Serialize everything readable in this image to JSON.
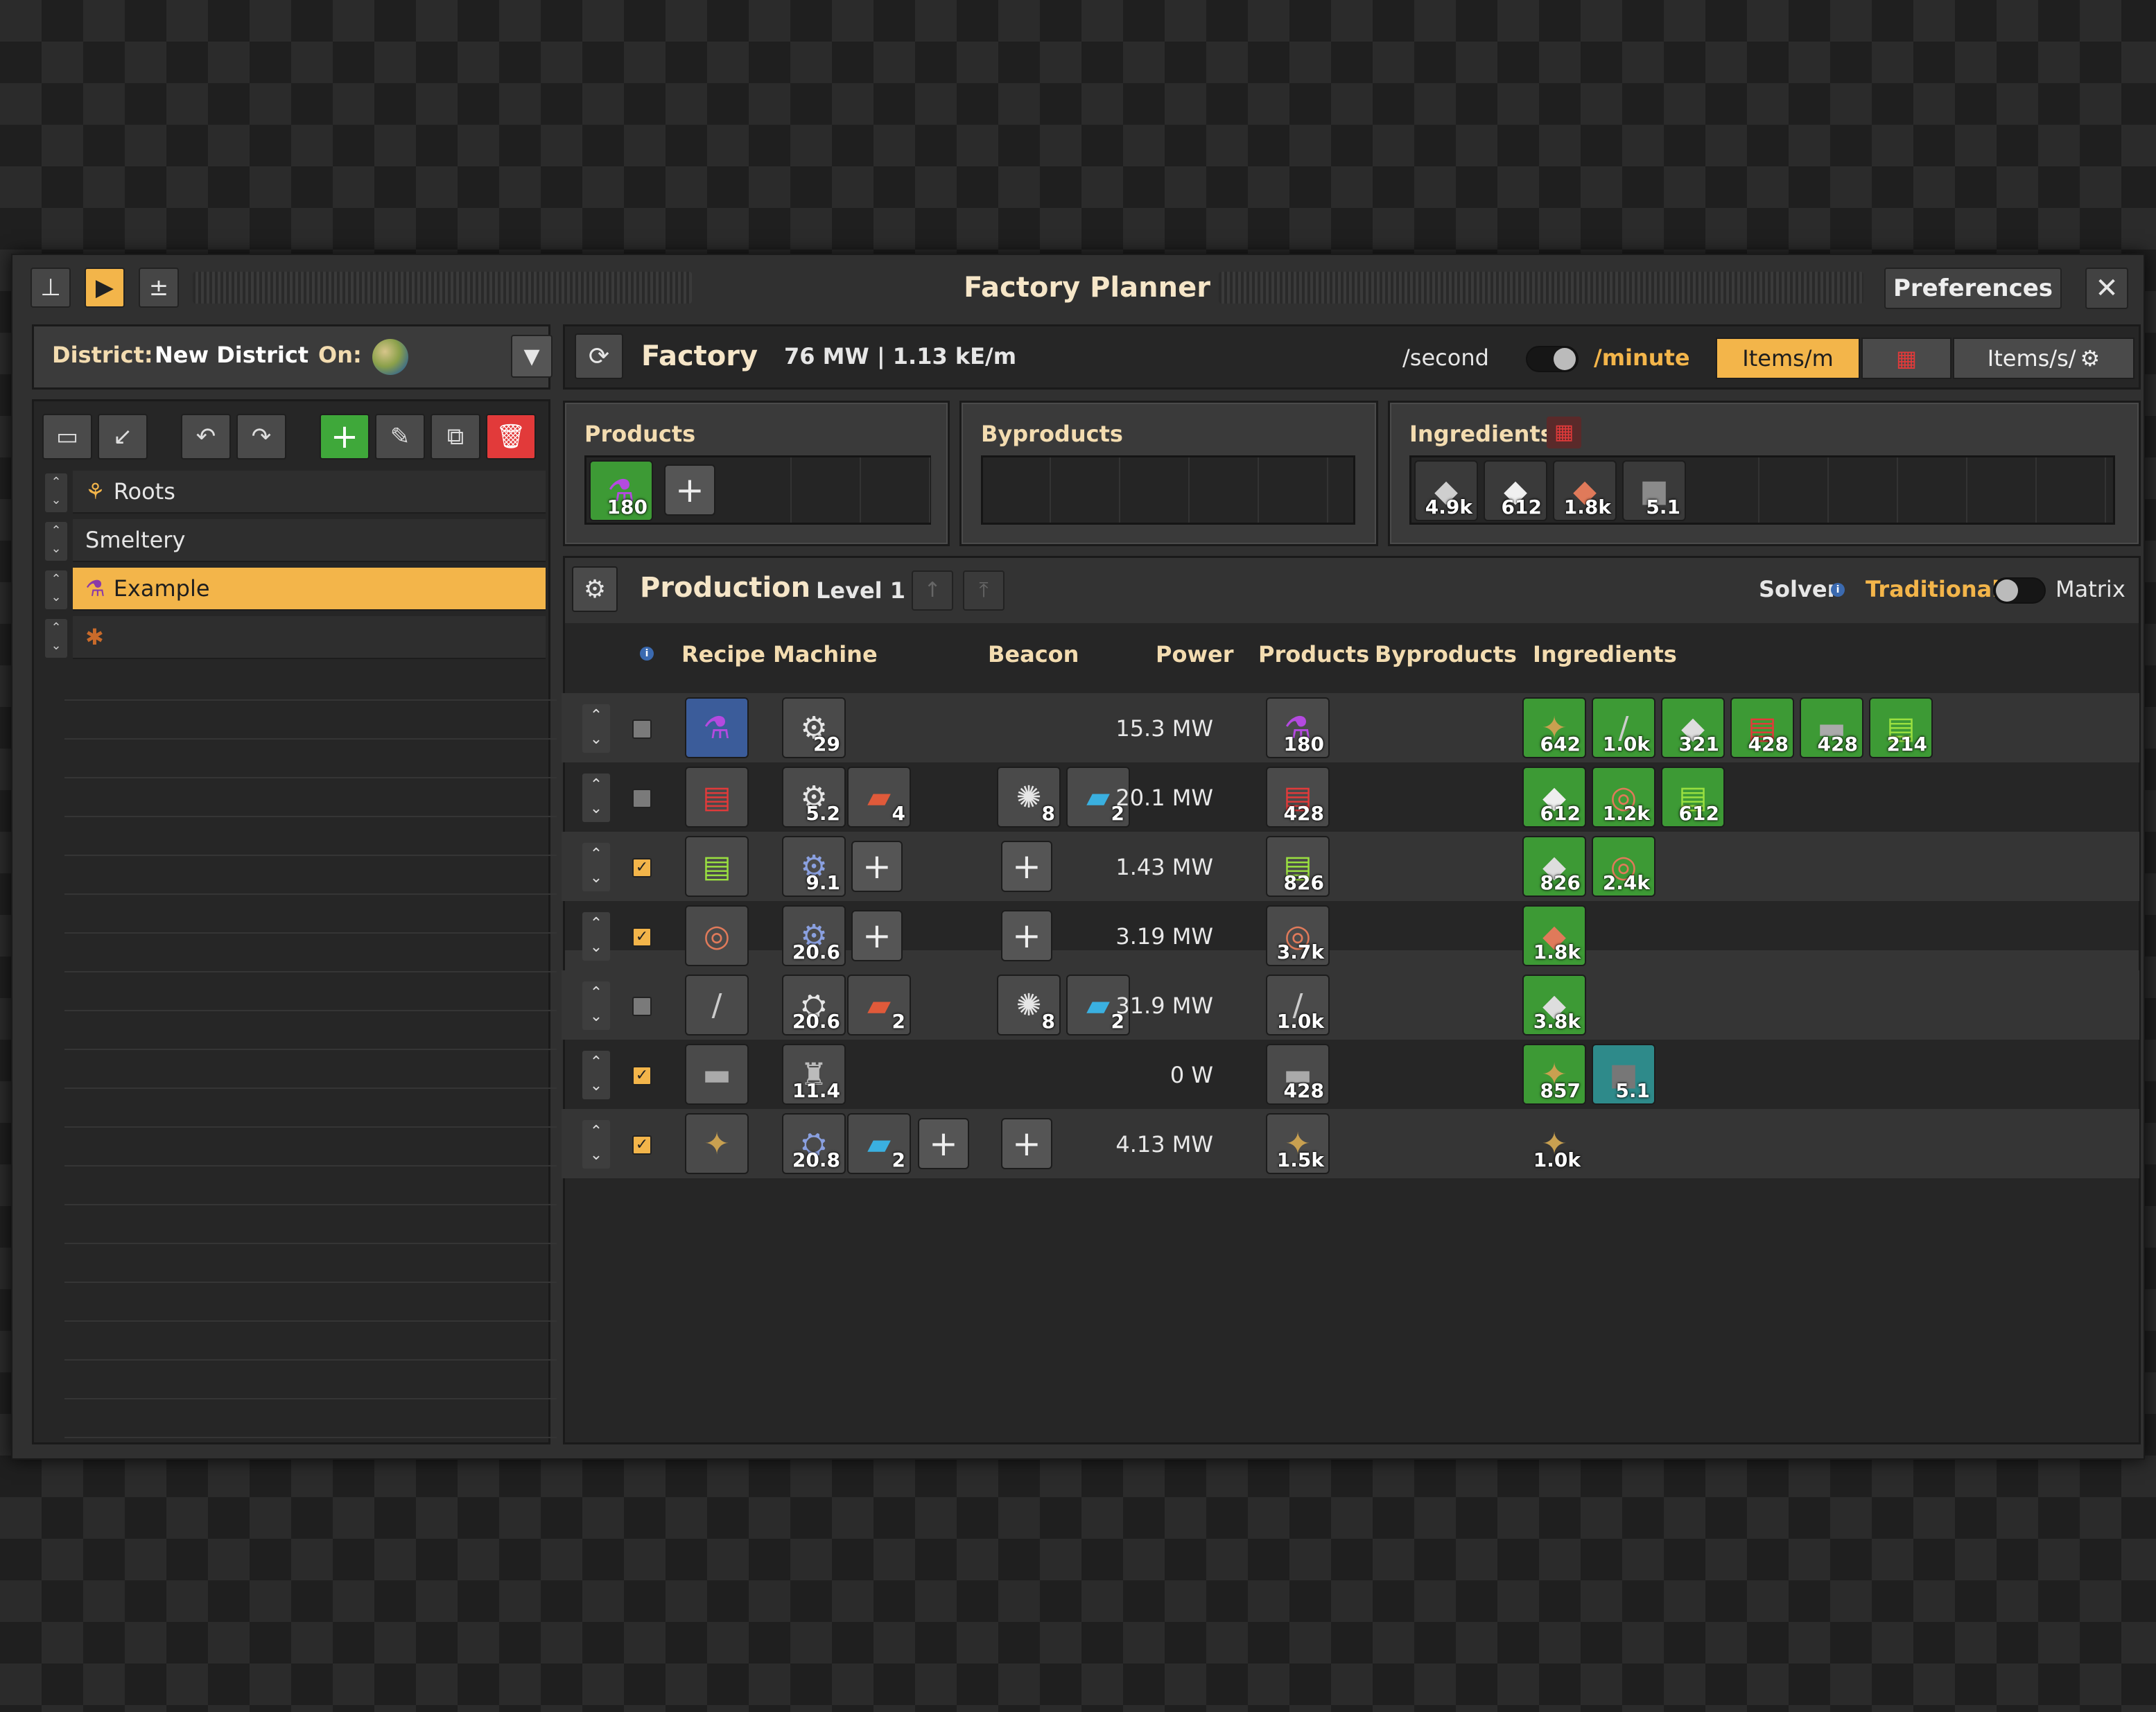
{
  "window": {
    "title": "Factory Planner",
    "preferences_label": "Preferences",
    "close_label": "✕",
    "pin_icon": "pin-icon",
    "pause_icon": "play-icon",
    "calc_icon": "plus-minus-icon"
  },
  "district": {
    "label": "District:",
    "name": "New District",
    "on_label": "On:",
    "planet_icon": "planet-icon"
  },
  "factory_list": {
    "items": [
      {
        "label": "Roots",
        "icon": "roots-icon",
        "selected": false
      },
      {
        "label": "Smeltery",
        "icon": "",
        "selected": false
      },
      {
        "label": "Example",
        "icon": "flask-icon",
        "selected": true
      },
      {
        "label": "",
        "icon": "spider-icon",
        "selected": false
      }
    ]
  },
  "factory_bar": {
    "title": "Factory",
    "stats": "76 MW | 1.13 kE/m",
    "per_second": "/second",
    "per_minute": "/minute",
    "view_items_m": "Items/m",
    "view_items_s": "Items/s/"
  },
  "products": {
    "title": "Products",
    "items": [
      {
        "icon": "purple-science-pack-icon",
        "count": "180"
      }
    ]
  },
  "byproducts": {
    "title": "Byproducts"
  },
  "ingredients": {
    "title": "Ingredients",
    "items": [
      {
        "icon": "iron-ore-icon",
        "count": "4.9k"
      },
      {
        "icon": "iron-plate-icon",
        "count": "612"
      },
      {
        "icon": "copper-ore-icon",
        "count": "1.8k"
      },
      {
        "icon": "stone-icon",
        "count": "5.1"
      }
    ]
  },
  "production": {
    "title": "Production",
    "level": "Level 1",
    "solver_label": "Solver",
    "solver_traditional": "Traditional",
    "solver_matrix": "Matrix",
    "columns": {
      "recipe": "Recipe",
      "machine": "Machine",
      "beacon": "Beacon",
      "power": "Power",
      "products": "Products",
      "byproducts": "Byproducts",
      "ingredients": "Ingredients"
    },
    "rows": [
      {
        "checked": false,
        "recipe_icon": "purple-science-icon",
        "machine": [
          {
            "icon": "assembler-icon",
            "count": "29"
          }
        ],
        "beacon": [],
        "power": "15.3 MW",
        "products": [
          {
            "icon": "purple-science-icon",
            "count": "180"
          }
        ],
        "ingredients": [
          {
            "icon": "rocks-icon",
            "count": "642"
          },
          {
            "icon": "rail-icon",
            "count": "1.0k"
          },
          {
            "icon": "iron-plate-icon",
            "count": "321"
          },
          {
            "icon": "red-circuit-icon",
            "count": "428"
          },
          {
            "icon": "stone-brick-icon",
            "count": "428"
          },
          {
            "icon": "green-circuit-icon",
            "count": "214"
          }
        ]
      },
      {
        "checked": false,
        "recipe_icon": "red-circuit-icon",
        "machine": [
          {
            "icon": "assembler-icon",
            "count": "5.2"
          },
          {
            "icon": "speed-module-icon",
            "count": "4"
          }
        ],
        "beacon": [
          {
            "icon": "beacon-icon",
            "count": "8"
          },
          {
            "icon": "efficiency-module-icon",
            "count": "2"
          }
        ],
        "power": "20.1 MW",
        "products": [
          {
            "icon": "red-circuit-icon",
            "count": "428"
          }
        ],
        "ingredients": [
          {
            "icon": "plastic-icon",
            "count": "612"
          },
          {
            "icon": "copper-cable-icon",
            "count": "1.2k"
          },
          {
            "icon": "green-circuit-icon",
            "count": "612"
          }
        ]
      },
      {
        "checked": true,
        "recipe_icon": "green-circuit-icon",
        "machine": [
          {
            "icon": "assembler-blue-icon",
            "count": "9.1"
          }
        ],
        "beacon": [],
        "power": "1.43 MW",
        "products": [
          {
            "icon": "green-circuit-icon",
            "count": "826"
          }
        ],
        "ingredients": [
          {
            "icon": "iron-plate-icon",
            "count": "826"
          },
          {
            "icon": "copper-cable-icon",
            "count": "2.4k"
          }
        ]
      },
      {
        "checked": true,
        "recipe_icon": "copper-cable-icon",
        "machine": [
          {
            "icon": "assembler-blue-icon",
            "count": "20.6"
          }
        ],
        "beacon": [],
        "power": "3.19 MW",
        "products": [
          {
            "icon": "copper-cable-icon",
            "count": "3.7k"
          }
        ],
        "ingredients": [
          {
            "icon": "copper-plate-icon",
            "count": "1.8k"
          }
        ]
      },
      {
        "checked": false,
        "recipe_icon": "rail-icon",
        "machine": [
          {
            "icon": "foundry-icon",
            "count": "20.6"
          },
          {
            "icon": "speed-module-icon",
            "count": "2"
          }
        ],
        "beacon": [
          {
            "icon": "beacon-icon",
            "count": "8"
          },
          {
            "icon": "efficiency-module-icon",
            "count": "2"
          }
        ],
        "power": "31.9 MW",
        "products": [
          {
            "icon": "rail-icon",
            "count": "1.0k"
          }
        ],
        "ingredients": [
          {
            "icon": "iron-plate-icon",
            "count": "3.8k"
          }
        ]
      },
      {
        "checked": true,
        "recipe_icon": "stone-brick-icon",
        "machine": [
          {
            "icon": "furnace-icon",
            "count": "11.4"
          }
        ],
        "beacon": [],
        "power": "0 W",
        "products": [
          {
            "icon": "stone-brick-icon",
            "count": "428"
          }
        ],
        "ingredients": [
          {
            "icon": "rocks-icon",
            "count": "857"
          },
          {
            "icon": "stone-icon",
            "count": "5.1"
          }
        ]
      },
      {
        "checked": true,
        "recipe_icon": "rocks-icon",
        "machine": [
          {
            "icon": "crusher-icon",
            "count": "20.8"
          },
          {
            "icon": "efficiency-module-icon",
            "count": "2"
          }
        ],
        "beacon": [],
        "power": "4.13 MW",
        "products": [
          {
            "icon": "rocks-icon",
            "count": "1.5k"
          }
        ],
        "ingredients": [
          {
            "icon": "rocks-icon",
            "count": "1.0k"
          }
        ]
      }
    ]
  },
  "colors": {
    "accent": "#f3b54a",
    "green": "#3d9a35",
    "red": "#e23a3a",
    "panel": "#262626"
  }
}
